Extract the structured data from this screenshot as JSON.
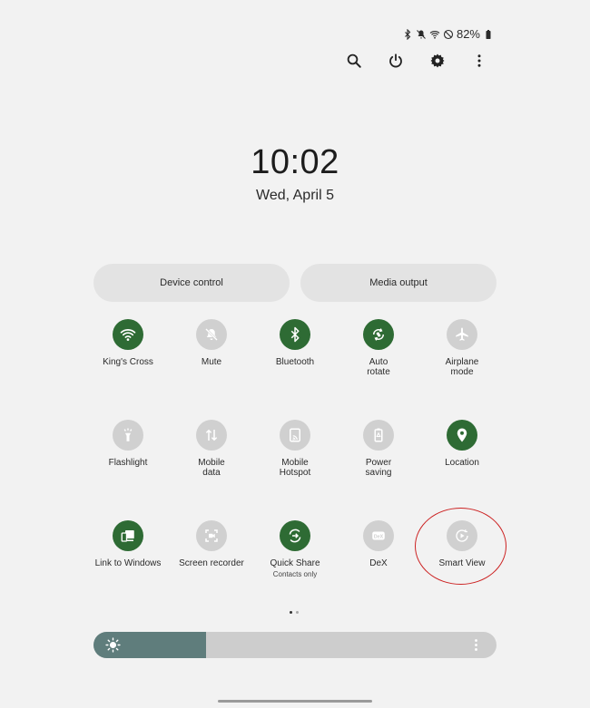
{
  "status_bar": {
    "icons": [
      "bluetooth-icon",
      "mute-icon",
      "wifi-icon",
      "do-not-disturb-icon"
    ],
    "battery_text": "82%"
  },
  "toolbar": {
    "icons": [
      "search-icon",
      "power-icon",
      "gear-icon",
      "more-vert-icon"
    ]
  },
  "clock": {
    "time": "10:02",
    "date": "Wed, April 5"
  },
  "quick_buttons": {
    "device_control": "Device control",
    "media_output": "Media output"
  },
  "tiles": [
    {
      "label": "King's Cross",
      "icon": "wifi-icon",
      "state": "on"
    },
    {
      "label": "Mute",
      "icon": "mute-icon",
      "state": "off"
    },
    {
      "label": "Bluetooth",
      "icon": "bluetooth-icon",
      "state": "on"
    },
    {
      "label": "Auto\nrotate",
      "icon": "rotate-icon",
      "state": "on"
    },
    {
      "label": "Airplane\nmode",
      "icon": "airplane-icon",
      "state": "off"
    },
    {
      "label": "Flashlight",
      "icon": "flashlight-icon",
      "state": "off"
    },
    {
      "label": "Mobile\ndata",
      "icon": "mobile-data-icon",
      "state": "off"
    },
    {
      "label": "Mobile\nHotspot",
      "icon": "hotspot-icon",
      "state": "off"
    },
    {
      "label": "Power\nsaving",
      "icon": "power-saving-icon",
      "state": "off"
    },
    {
      "label": "Location",
      "icon": "location-icon",
      "state": "on"
    },
    {
      "label": "Link to Windows",
      "icon": "link-windows-icon",
      "state": "on"
    },
    {
      "label": "Screen recorder",
      "icon": "screen-recorder-icon",
      "state": "off"
    },
    {
      "label": "Quick Share",
      "sublabel": "Contacts only",
      "icon": "quick-share-icon",
      "state": "on"
    },
    {
      "label": "DeX",
      "icon": "dex-icon",
      "state": "off"
    },
    {
      "label": "Smart View",
      "icon": "smart-view-icon",
      "state": "off"
    }
  ],
  "page_indicator": {
    "pages": 2,
    "current": 1
  },
  "brightness": {
    "level": 0.28,
    "icon": "sun-icon",
    "more_icon": "more-vert-icon"
  },
  "colors": {
    "tile_on": "#2e6b34",
    "tile_off": "#d0d0d0",
    "brightness_fill": "#5f7d7c",
    "annotation": "#cc2222"
  }
}
